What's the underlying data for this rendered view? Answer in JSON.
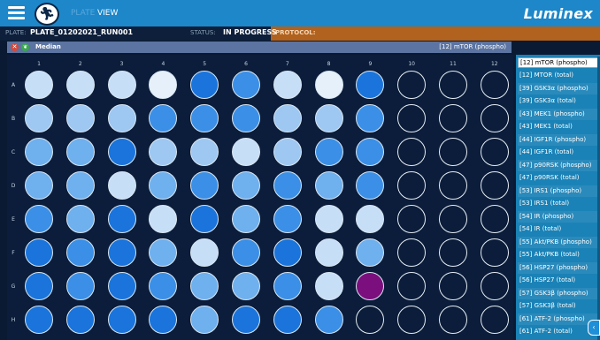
{
  "header": {
    "menu_icon": "hamburger-menu-icon",
    "run_icon": "running-person-icon",
    "nav_prev": "PLATE",
    "nav_view": "VIEW",
    "logo": "Luminex"
  },
  "infobar": {
    "plate_label": "PLATE:",
    "plate_value": "PLATE_01202021_RUN001",
    "status_label": "STATUS:",
    "status_value": "IN PROGRESS",
    "protocol_label": "PROTOCOL:"
  },
  "subheader": {
    "metric": "Median",
    "selected_analyte": "[12] mTOR (phospho)",
    "close_icon": "close-icon",
    "leaf_icon": "leaf-icon"
  },
  "plate": {
    "columns": [
      "1",
      "2",
      "3",
      "4",
      "5",
      "6",
      "7",
      "8",
      "9",
      "10",
      "11",
      "12"
    ],
    "rows": [
      "A",
      "B",
      "C",
      "D",
      "E",
      "F",
      "G",
      "H"
    ],
    "colors": {
      "pale": "#e6f0fb",
      "light": "#c7def7",
      "lmid": "#9ec8f2",
      "mid": "#6fb0ee",
      "blue": "#3b8fe6",
      "deep": "#1a74db",
      "purple": "#7b0f7d"
    },
    "wells": [
      [
        "light",
        "light",
        "light",
        "pale",
        "deep",
        "blue",
        "light",
        "pale",
        "deep",
        "empty",
        "empty",
        "empty"
      ],
      [
        "lmid",
        "lmid",
        "lmid",
        "blue",
        "blue",
        "blue",
        "lmid",
        "lmid",
        "blue",
        "empty",
        "empty",
        "empty"
      ],
      [
        "mid",
        "mid",
        "deep",
        "lmid",
        "lmid",
        "light",
        "lmid",
        "blue",
        "blue",
        "empty",
        "empty",
        "empty"
      ],
      [
        "mid",
        "mid",
        "light",
        "mid",
        "blue",
        "mid",
        "blue",
        "mid",
        "blue",
        "empty",
        "empty",
        "empty"
      ],
      [
        "blue",
        "mid",
        "deep",
        "light",
        "deep",
        "mid",
        "blue",
        "light",
        "light",
        "empty",
        "empty",
        "empty"
      ],
      [
        "deep",
        "blue",
        "deep",
        "mid",
        "light",
        "blue",
        "deep",
        "light",
        "mid",
        "empty",
        "empty",
        "empty"
      ],
      [
        "deep",
        "blue",
        "deep",
        "blue",
        "mid",
        "mid",
        "blue",
        "light",
        "purple",
        "empty",
        "empty",
        "empty"
      ],
      [
        "deep",
        "deep",
        "deep",
        "deep",
        "mid",
        "deep",
        "deep",
        "blue",
        "empty",
        "empty",
        "empty",
        "empty"
      ]
    ]
  },
  "analytes": {
    "selected": "[12] mTOR (phospho)",
    "items": [
      "[12] MTOR (total)",
      "[39] GSK3α (phospho)",
      "[39] GSK3α (total)",
      "[43] MEK1 (phospho)",
      "[43] MEK1 (total)",
      "[44] IGF1R (phospho)",
      "[44] IGF1R (total)",
      "[47] p90RSK (phospho)",
      "[47] p90RSK (total)",
      "[53] IRS1 (phospho)",
      "[53] IRS1 (total)",
      "[54] IR (phospho)",
      "[54] IR (total)",
      "[55] Akt/PKB (phospho)",
      "[55] Akt/PKB (total)",
      "[56] HSP27 (phospho)",
      "[56] HSP27 (total)",
      "[57] GSK3β (phospho)",
      "[57] GSK3β (total)",
      "[61] ATF-2 (phospho)",
      "[61] ATF-2 (total)"
    ]
  },
  "corner_icon": "chevron-left-icon"
}
